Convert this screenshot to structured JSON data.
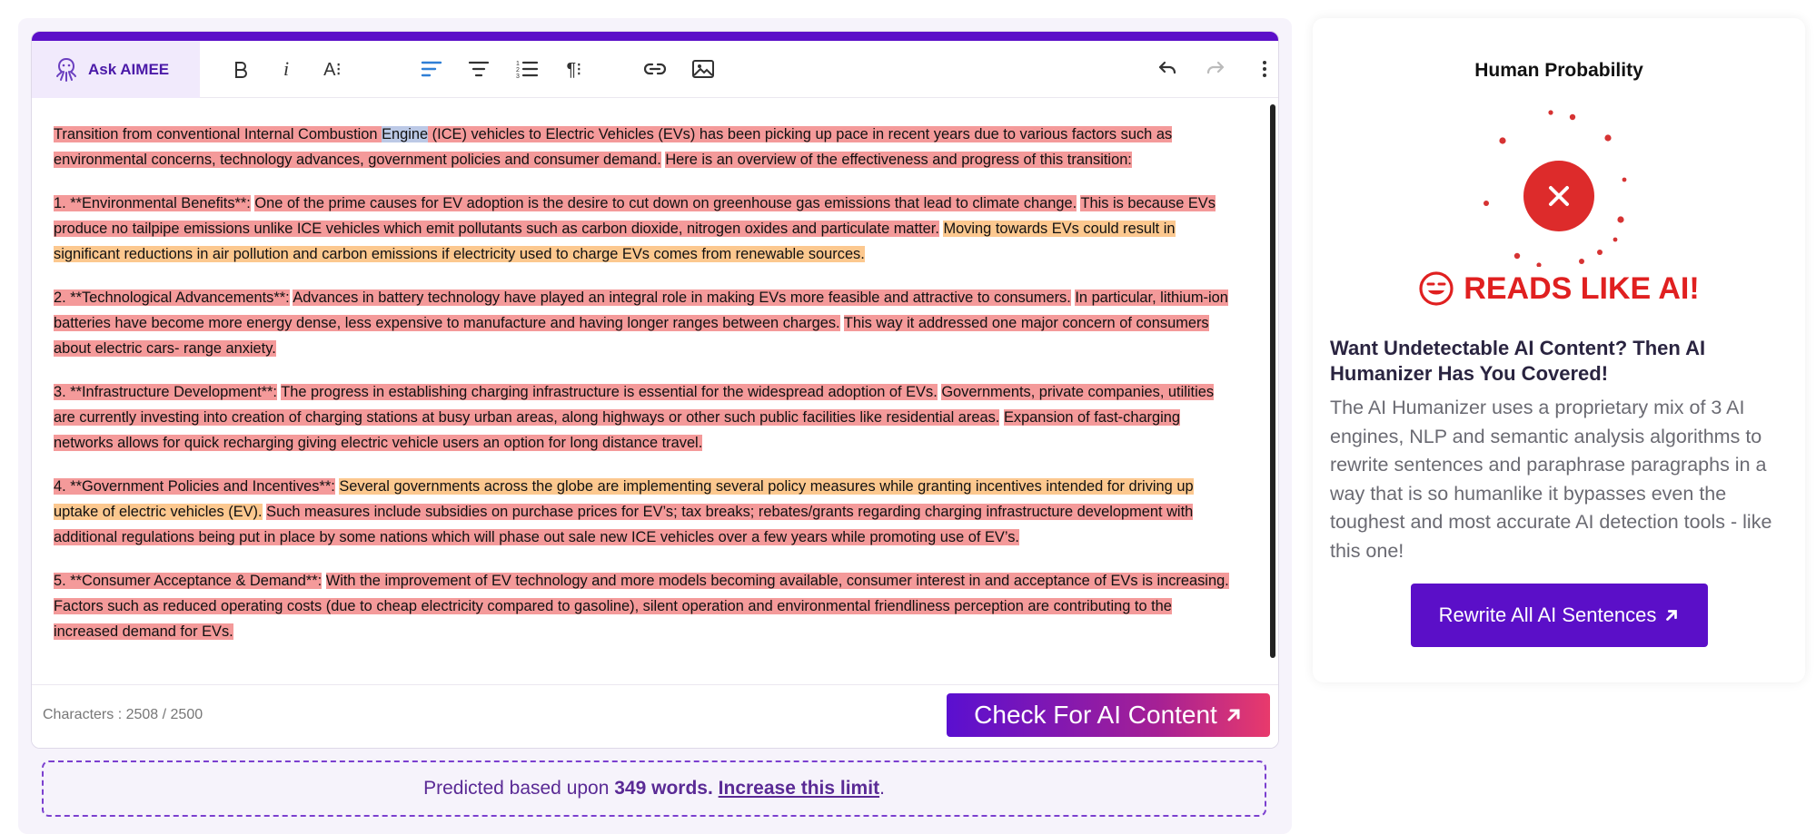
{
  "toolbar": {
    "ask_label": "Ask AIMEE",
    "italic_glyph": "i",
    "fontsize_glyph": "A⁝",
    "paragraph_glyph": "¶⁝"
  },
  "content": {
    "p1": {
      "a": "Transition from conventional Internal Combustion ",
      "sel": "Engine",
      "b": " (ICE) vehicles to Electric Vehicles (EVs) has been picking up pace in recent years due to various factors such as environmental concerns, technology advances, government policies and consumer demand.",
      "c": "Here is an overview of the effectiveness and progress of this transition:"
    },
    "p2": {
      "a": "1.    **Environmental Benefits**:",
      "b": "One of the prime causes for EV adoption is the desire to cut down on greenhouse gas emissions that lead to climate change.",
      "c": "This is because EVs produce no tailpipe emissions unlike ICE vehicles which emit pollutants such as carbon dioxide, nitrogen oxides and particulate matter.",
      "d": "Moving towards EVs could result in significant reductions in air pollution and carbon emissions if electricity used to charge EVs comes from renewable sources."
    },
    "p3": {
      "a": "2.    **Technological Advancements**:",
      "b": "Advances in battery technology have played an integral role in making EVs more feasible and attractive to consumers.",
      "c": "In particular, lithium-ion batteries have become more energy dense, less expensive to manufacture and having longer ranges between charges.",
      "d": "This way it addressed one major concern of consumers about electric cars- range anxiety."
    },
    "p4": {
      "a": "3.    **Infrastructure Development**:",
      "b": "The progress in establishing charging infrastructure is essential for the widespread adoption of EVs.",
      "c": "Governments, private companies, utilities are currently investing into creation of charging stations at busy urban areas, along highways or other such public facilities like residential areas.",
      "d": "Expansion of fast-charging networks allows for quick recharging giving electric vehicle users an option for long distance travel."
    },
    "p5": {
      "a": "4.    **Government Policies and Incentives**:",
      "b": "Several governments across the globe are implementing several policy measures while granting incentives intended for driving up uptake of electric vehicles (EV).",
      "c": "Such measures include subsidies on purchase prices for EV’s; tax breaks; rebates/grants regarding charging infrastructure development with additional regulations being put in place by some nations which will phase out sale new ICE vehicles over a few years while promoting use of EV’s."
    },
    "p6": {
      "a": "5.    **Consumer Acceptance & Demand**:",
      "b": "With the improvement of EV technology and more models becoming available, consumer interest in and acceptance of EVs is increasing.",
      "c": "Factors such as reduced operating costs (due to cheap electricity compared to gasoline), silent operation and environmental friendliness perception are contributing to the increased demand for EVs."
    }
  },
  "footer": {
    "char_label": "Characters : ",
    "char_count": "2508",
    "char_limit": " / 2500",
    "check_label": "Check For AI Content"
  },
  "prediction": {
    "prefix": "Predicted based upon ",
    "words": "349 words.",
    "link": "Increase this limit",
    "suffix": "."
  },
  "panel": {
    "title": "Human Probability",
    "verdict": "READS LIKE AI!",
    "cta_title": "Want Undetectable AI Content? Then AI Humanizer Has You Covered!",
    "cta_text": "The AI Humanizer uses a proprietary mix of 3 AI engines, NLP and semantic analysis algorithms to rewrite sentences and paraphrase paragraphs in a way that is so humanlike it bypasses even the toughest and most accurate AI detection tools - like this one!",
    "rewrite_label": "Rewrite All AI Sentences"
  },
  "colors": {
    "accent": "#5b0fc8",
    "highlight_ai": "#f49a9a",
    "highlight_mixed": "#fcc88f",
    "verdict_red": "#e02020"
  }
}
